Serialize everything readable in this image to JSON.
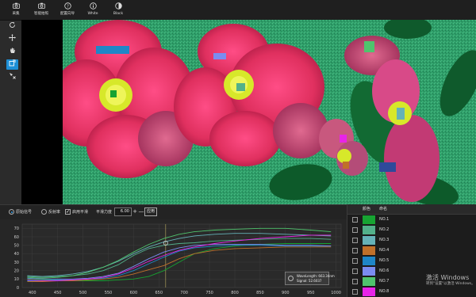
{
  "toolbar": {
    "items": [
      {
        "icon": "camera-icon",
        "label": "采集"
      },
      {
        "icon": "camera-icon",
        "label": "智能拍照"
      },
      {
        "icon": "help-icon",
        "label": "配置向导"
      },
      {
        "icon": "info-icon",
        "label": "White"
      },
      {
        "icon": "contrast-icon",
        "label": "Black"
      }
    ]
  },
  "left_tools": [
    {
      "icon": "rotate-icon"
    },
    {
      "icon": "move-icon"
    },
    {
      "icon": "hand-icon"
    },
    {
      "icon": "select-roi-icon",
      "active": true
    },
    {
      "icon": "pointer-cross-icon"
    }
  ],
  "controls": {
    "radio_original": "原始信号",
    "radio_reflectance": "反射率",
    "smoothing_label": "启用平滑",
    "smoothing_checked": true,
    "strength_label": "平滑力度",
    "strength_value": "6.00",
    "plus": "+",
    "minus": "—",
    "apply_label": "应用"
  },
  "rois": [
    {
      "name": "NO.1",
      "color": "#17a332"
    },
    {
      "name": "NO.2",
      "color": "#52b08a"
    },
    {
      "name": "NO.3",
      "color": "#65b2b8"
    },
    {
      "name": "NO.4",
      "color": "#c0702a"
    },
    {
      "name": "NO.5",
      "color": "#1f86c7"
    },
    {
      "name": "NO.6",
      "color": "#7b8cf0"
    },
    {
      "name": "NO.7",
      "color": "#4fc46d"
    },
    {
      "name": "NO.8",
      "color": "#e824e8"
    }
  ],
  "legend": {
    "color_header": "颜色",
    "name_header": "命名"
  },
  "tooltip": {
    "wavelength": "WaveLength: 663.34nm",
    "signal": "Signal: 52.6037"
  },
  "chart_data": {
    "type": "line",
    "ylim": [
      0,
      75
    ],
    "yticks": [
      "70",
      "60",
      "50",
      "40",
      "30",
      "20",
      "10",
      "0"
    ],
    "xlim": [
      380,
      1010
    ],
    "xticks": [
      "400",
      "450",
      "500",
      "550",
      "600",
      "650",
      "700",
      "750",
      "800",
      "850",
      "900",
      "950",
      "1000"
    ],
    "cursor_x": 663.34,
    "series": [
      {
        "name": "NO.1",
        "color": "#17a332",
        "x": [
          390,
          420,
          450,
          480,
          510,
          540,
          570,
          600,
          630,
          660,
          690,
          720,
          760,
          800,
          850,
          900,
          950,
          990
        ],
        "y": [
          10,
          9,
          9,
          8,
          8,
          8,
          9,
          10,
          13,
          20,
          30,
          40,
          46,
          49,
          51,
          52,
          52,
          52
        ]
      },
      {
        "name": "NO.2",
        "color": "#52b08a",
        "x": [
          390,
          420,
          450,
          480,
          510,
          540,
          570,
          600,
          630,
          660,
          690,
          720,
          760,
          800,
          850,
          900,
          950,
          990
        ],
        "y": [
          13,
          12,
          13,
          14,
          16,
          20,
          27,
          38,
          46,
          50,
          52,
          53,
          55,
          56,
          57,
          58,
          58,
          57
        ]
      },
      {
        "name": "NO.3",
        "color": "#65b2b8",
        "x": [
          390,
          420,
          450,
          480,
          510,
          540,
          570,
          600,
          630,
          660,
          690,
          720,
          760,
          800,
          850,
          900,
          950,
          990
        ],
        "y": [
          14,
          13,
          14,
          16,
          19,
          24,
          31,
          40,
          48,
          54,
          58,
          61,
          63,
          64,
          64,
          63,
          62,
          61
        ]
      },
      {
        "name": "NO.4",
        "color": "#c0702a",
        "x": [
          390,
          420,
          450,
          480,
          510,
          540,
          570,
          600,
          630,
          660,
          690,
          720,
          760,
          800,
          850,
          900,
          950,
          990
        ],
        "y": [
          7,
          7,
          8,
          8,
          9,
          10,
          12,
          16,
          21,
          26,
          34,
          40,
          44,
          46,
          47,
          48,
          48,
          48
        ]
      },
      {
        "name": "NO.5",
        "color": "#1f86c7",
        "x": [
          390,
          420,
          450,
          480,
          510,
          540,
          570,
          600,
          630,
          660,
          690,
          720,
          760,
          800,
          850,
          900,
          950,
          990
        ],
        "y": [
          8,
          8,
          9,
          9,
          10,
          11,
          14,
          20,
          28,
          36,
          43,
          47,
          49,
          50,
          50,
          49,
          49,
          49
        ]
      },
      {
        "name": "NO.6",
        "color": "#7b8cf0",
        "x": [
          390,
          420,
          450,
          480,
          510,
          540,
          570,
          600,
          630,
          660,
          690,
          720,
          760,
          800,
          850,
          900,
          950,
          990
        ],
        "y": [
          11,
          10,
          10,
          10,
          11,
          13,
          17,
          25,
          34,
          42,
          47,
          50,
          51,
          51,
          51,
          50,
          50,
          49
        ]
      },
      {
        "name": "NO.7",
        "color": "#4fc46d",
        "x": [
          390,
          420,
          450,
          480,
          510,
          540,
          570,
          600,
          630,
          660,
          690,
          720,
          760,
          800,
          850,
          900,
          950,
          990
        ],
        "y": [
          12,
          11,
          12,
          14,
          18,
          24,
          32,
          42,
          51,
          58,
          63,
          66,
          68,
          69,
          70,
          70,
          68,
          66
        ]
      },
      {
        "name": "NO.8",
        "color": "#e824e8",
        "x": [
          390,
          420,
          450,
          480,
          510,
          540,
          570,
          600,
          630,
          660,
          690,
          720,
          760,
          800,
          850,
          900,
          950,
          990
        ],
        "y": [
          9,
          8,
          8,
          9,
          10,
          12,
          16,
          23,
          31,
          38,
          44,
          48,
          52,
          55,
          58,
          60,
          62,
          62
        ]
      }
    ]
  },
  "watermark": {
    "line1": "激活 Windows",
    "line2": "转到\"设置\"以激活 Windows。"
  }
}
